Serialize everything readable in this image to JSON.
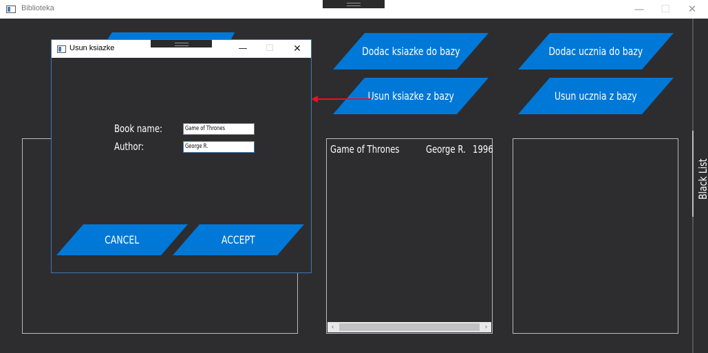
{
  "main_window": {
    "title": "Biblioteka",
    "controls": {
      "minimize": "—",
      "maximize": "☐",
      "close": "✕"
    }
  },
  "actions": {
    "add_book": "Dodac ksiazke do bazy",
    "add_student": "Dodac ucznia do bazy",
    "remove_book": "Usun ksiazke z bazy",
    "remove_student": "Usun ucznia z bazy"
  },
  "books_list": {
    "rows": [
      {
        "title": "Game of Thrones",
        "author": "George R.",
        "year": "1996"
      }
    ]
  },
  "side_tab": {
    "label": "Black List"
  },
  "dialog": {
    "title": "Usun ksiazke",
    "controls": {
      "minimize": "—",
      "maximize": "☐",
      "close": "✕"
    },
    "book_name_label": "Book name:",
    "book_name_value": "Game of Thrones",
    "author_label": "Author:",
    "author_value": "George R.",
    "cancel_label": "CANCEL",
    "accept_label": "ACCEPT"
  },
  "colors": {
    "background": "#2d2d30",
    "accent_blue": "#0078d7",
    "arrow_red": "#e81123",
    "panel_border": "#bdbdbd"
  },
  "icons": [
    "app-icon",
    "minimize-icon",
    "maximize-icon",
    "close-icon",
    "scroll-left-icon",
    "scroll-right-icon",
    "red-arrow-icon"
  ]
}
